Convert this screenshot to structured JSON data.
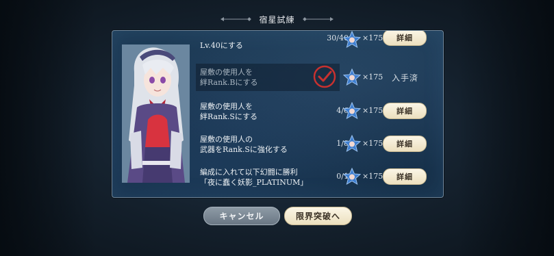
{
  "dialog": {
    "title": "宿星試練"
  },
  "missions": [
    {
      "line1": "Lv.40にする",
      "line2": "",
      "progress": "30/40",
      "reward": "×175",
      "action": "詳細",
      "status": "partial"
    },
    {
      "line1": "屋敷の使用人を",
      "line2": "絆Rank.Bにする",
      "progress": "",
      "reward": "×175",
      "action": "入手済",
      "status": "completed"
    },
    {
      "line1": "屋敷の使用人を",
      "line2": "絆Rank.Sにする",
      "progress": "4/6",
      "reward": "×175",
      "action": "詳細",
      "status": "in-progress"
    },
    {
      "line1": "屋敷の使用人の",
      "line2": "武器をRank.Sに強化する",
      "progress": "1/8",
      "reward": "×175",
      "action": "詳細",
      "status": "in-progress"
    },
    {
      "line1": "編成に入れて以下幻闘に勝利",
      "line2": "「夜に蠢く妖影_PLATINUM」",
      "progress": "0/1",
      "reward": "×175",
      "action": "詳細",
      "status": "in-progress"
    }
  ],
  "footer": {
    "cancel_label": "キャンセル",
    "confirm_label": "限界突破へ"
  },
  "colors": {
    "panel_bg": "#1a3550",
    "button_cream": "#f3ead2",
    "check_red": "#c8312f",
    "star_blue": "#3f7fd0"
  },
  "icons": {
    "reward": "star-character-icon",
    "completed": "checkmark-icon"
  }
}
